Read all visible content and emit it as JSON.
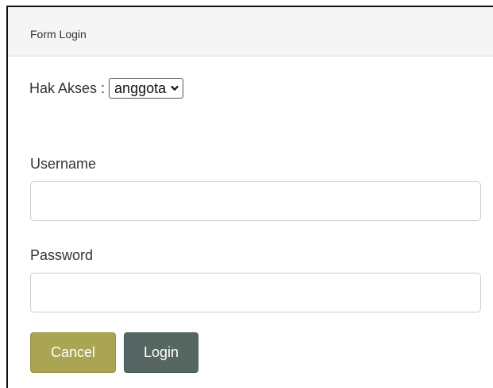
{
  "form": {
    "title": "Form Login"
  },
  "access": {
    "label": "Hak Akses :",
    "selected": "anggota"
  },
  "username": {
    "label": "Username",
    "value": ""
  },
  "password": {
    "label": "Password",
    "value": ""
  },
  "buttons": {
    "cancel_label": "Cancel",
    "login_label": "Login"
  },
  "colors": {
    "cancel": "#a9a553",
    "login": "#566763",
    "heading_bg": "#f5f5f5"
  },
  "icons": {
    "select_arrow": "chevron-down-icon"
  }
}
